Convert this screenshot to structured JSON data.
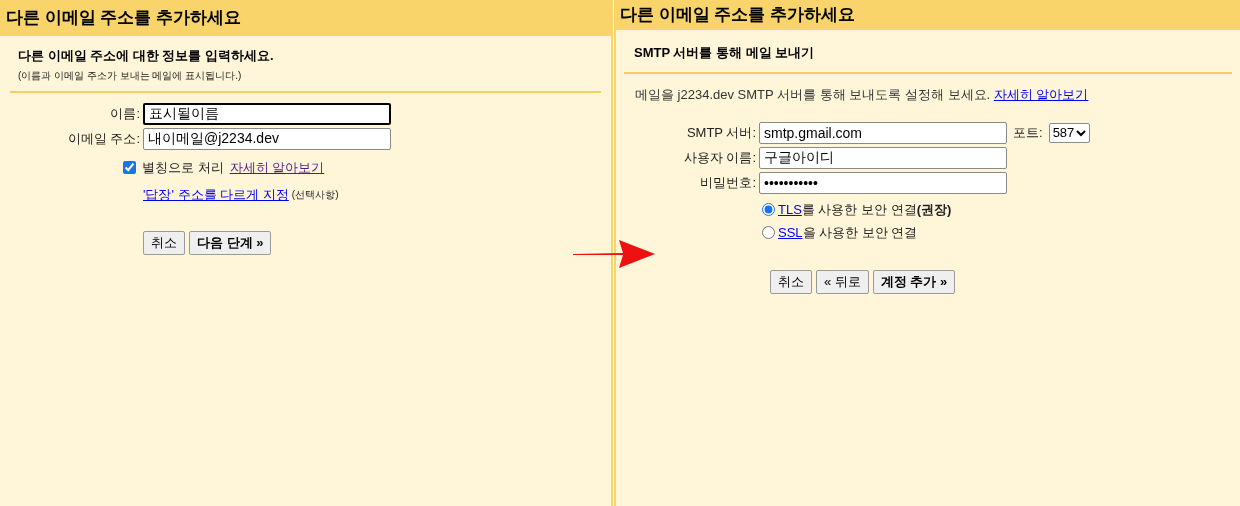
{
  "left_panel": {
    "title": "다른 이메일 주소를 추가하세요",
    "heading": "다른 이메일 주소에 대한 정보를 입력하세요.",
    "note": "(이름과 이메일 주소가 보내는 메일에 표시됩니다.)",
    "fields": [
      {
        "label": "이름:",
        "value": "표시될이름",
        "focused": true
      },
      {
        "label": "이메일 주소:",
        "value": "내이메일@j2234.dev",
        "focused": false
      }
    ],
    "alias": {
      "label": "별칭으로 처리",
      "checked": true,
      "link": "자세히 알아보기"
    },
    "reply_link": "'답장' 주소를 다르게 지정",
    "reply_note": "(선택사항)",
    "buttons": [
      {
        "label": "취소",
        "emphasis": false
      },
      {
        "label": "다음 단계 »",
        "emphasis": true
      }
    ]
  },
  "right_panel": {
    "title": "다른 이메일 주소를 추가하세요",
    "heading": "SMTP 서버를 통해 메일 보내기",
    "intro": "메일을 j2234.dev SMTP 서버를 통해 보내도록 설정해 보세요.",
    "intro_link": "자세히 알아보기",
    "fields": [
      {
        "label": "SMTP 서버:",
        "value": "smtp.gmail.com",
        "focused": false
      },
      {
        "label": "사용자 이름:",
        "value": "구글아이디",
        "focused": false
      },
      {
        "label": "비밀번호:",
        "value": "•••••••••••",
        "focused": false
      }
    ],
    "port": {
      "label": "포트:",
      "value": "587"
    },
    "security": [
      {
        "link": "TLS",
        "text": "를 사용한 보안 연결**(권장)**",
        "selected": true
      },
      {
        "link": "SSL",
        "text": "을 사용한 보안 연결",
        "selected": false
      }
    ],
    "buttons": [
      {
        "label": "취소",
        "emphasis": false
      },
      {
        "label": "« 뒤로",
        "emphasis": false
      },
      {
        "label": "계정 추가 »",
        "emphasis": true
      }
    ]
  }
}
